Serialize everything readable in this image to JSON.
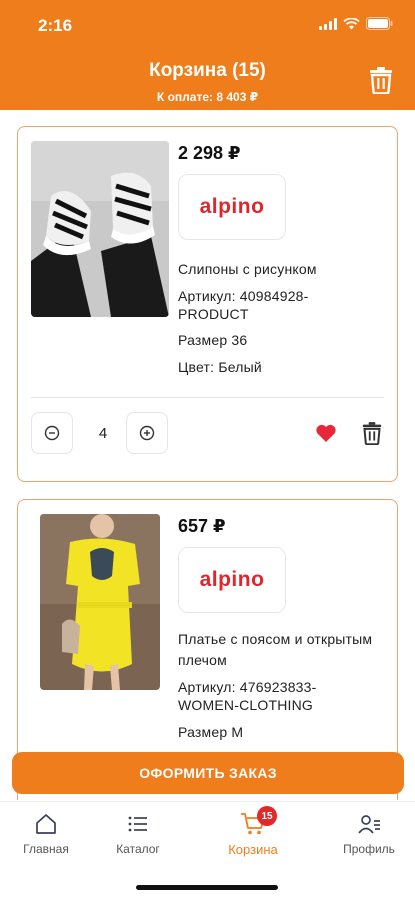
{
  "status": {
    "time": "2:16"
  },
  "header": {
    "title": "Корзина (15)",
    "subtitle": "К оплате: 8 403 ₽",
    "accent_color": "#f07d1b",
    "clear_icon": "trash-icon"
  },
  "cart": {
    "items": [
      {
        "price": "2 298 ₽",
        "brand": "alpino",
        "name": "Слипоны с рисунком",
        "article_line1": "Артикул: 40984928-",
        "article_line2": "PRODUCT",
        "size": "Размер 36",
        "color": "Цвет: Белый",
        "quantity": "4"
      },
      {
        "price": "657 ₽",
        "brand": "alpino",
        "name_line1": "Платье с поясом и открытым",
        "name_line2": "плечом",
        "article_line1": "Артикул: 476923833-",
        "article_line2": "WOMEN-CLOTHING",
        "size": "Размер M"
      }
    ]
  },
  "checkout": {
    "label": "ОФОРМИТЬ ЗАКАЗ"
  },
  "tabbar": {
    "items": [
      {
        "label": "Главная",
        "icon": "home-icon"
      },
      {
        "label": "Каталог",
        "icon": "list-icon"
      },
      {
        "label": "Корзина",
        "icon": "cart-icon",
        "badge": "15",
        "active": true
      },
      {
        "label": "Профиль",
        "icon": "profile-icon"
      }
    ]
  }
}
